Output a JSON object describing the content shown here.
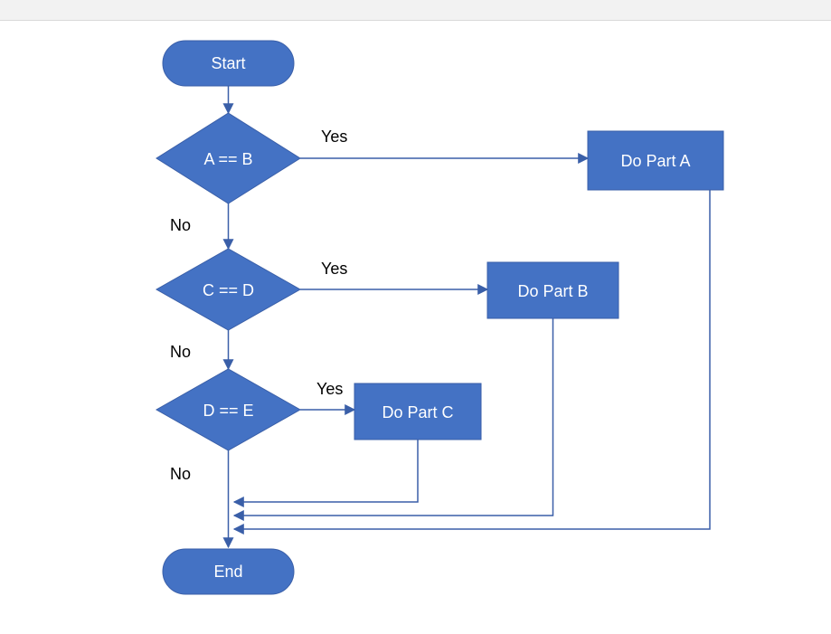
{
  "flowchart": {
    "start": "Start",
    "end": "End",
    "decision1": {
      "condition": "A == B",
      "yes": "Yes",
      "no": "No"
    },
    "decision2": {
      "condition": "C == D",
      "yes": "Yes",
      "no": "No"
    },
    "decision3": {
      "condition": "D == E",
      "yes": "Yes",
      "no": "No"
    },
    "processA": "Do Part A",
    "processB": "Do Part B",
    "processC": "Do Part C"
  },
  "colors": {
    "nodeFill": "#4472C4",
    "nodeStroke": "#3A5FA8",
    "text": "#ffffff",
    "label": "#000000"
  }
}
